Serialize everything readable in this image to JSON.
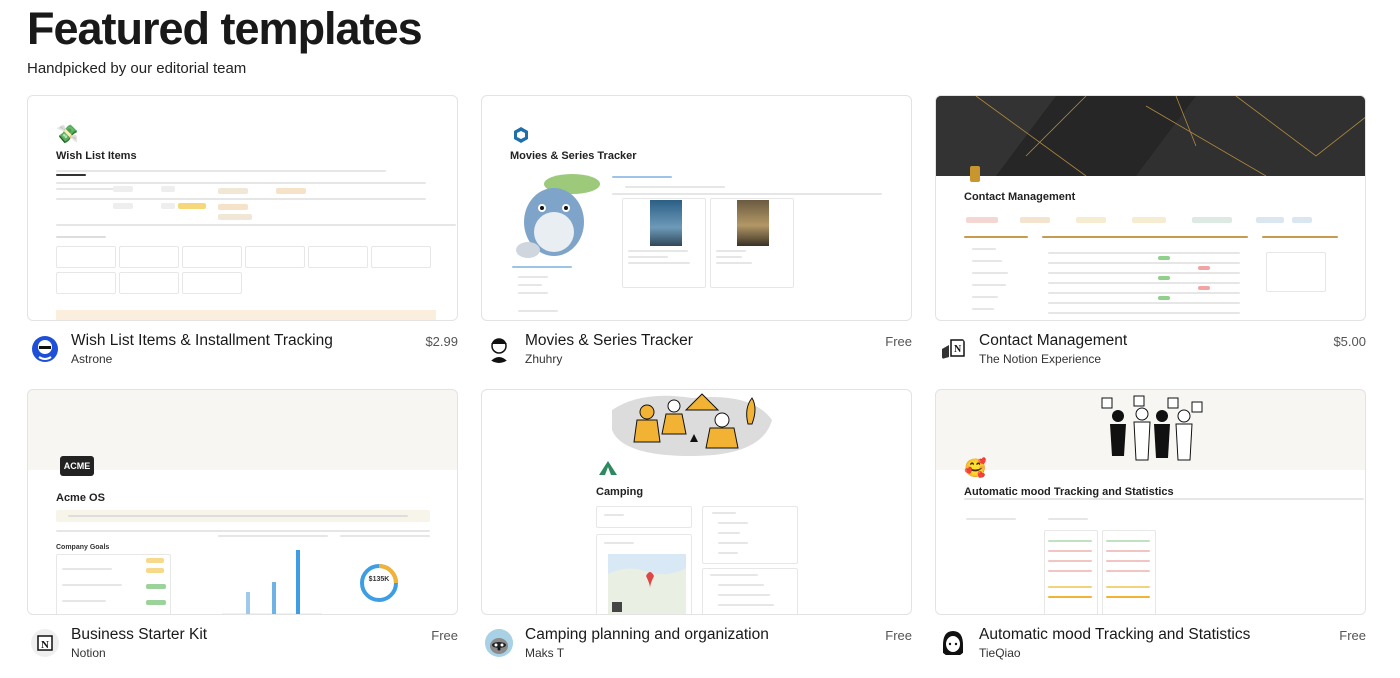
{
  "header": {
    "title": "Featured templates",
    "subtitle": "Handpicked by our editorial team"
  },
  "cards": [
    {
      "title": "Wish List Items & Installment Tracking",
      "author": "Astrone",
      "price": "$2.99",
      "preview_heading": "Wish List Items"
    },
    {
      "title": "Movies & Series Tracker",
      "author": "Zhuhry",
      "price": "Free",
      "preview_heading": "Movies & Series Tracker"
    },
    {
      "title": "Contact Management",
      "author": "The Notion Experience",
      "price": "$5.00",
      "preview_heading": "Contact Management"
    },
    {
      "title": "Business Starter Kit",
      "author": "Notion",
      "price": "Free",
      "preview_heading": "Acme OS",
      "preview_logo": "ACME",
      "preview_section": "Company Goals",
      "preview_ring_value": "$135K"
    },
    {
      "title": "Camping planning and organization",
      "author": "Maks T",
      "price": "Free",
      "preview_heading": "Camping"
    },
    {
      "title": "Automatic mood Tracking and Statistics",
      "author": "TieQiao",
      "price": "Free",
      "preview_heading": "Automatic mood Tracking and Statistics"
    }
  ],
  "icons": {
    "money": "money-bag-emoji",
    "heart_face": "smiling-face-with-hearts-emoji",
    "tent": "tent-icon"
  },
  "colors": {
    "border": "#e3e3e3",
    "title": "#191919",
    "price": "#555555",
    "accent_orange": "#f2b233",
    "accent_blue": "#3d9ee3"
  }
}
